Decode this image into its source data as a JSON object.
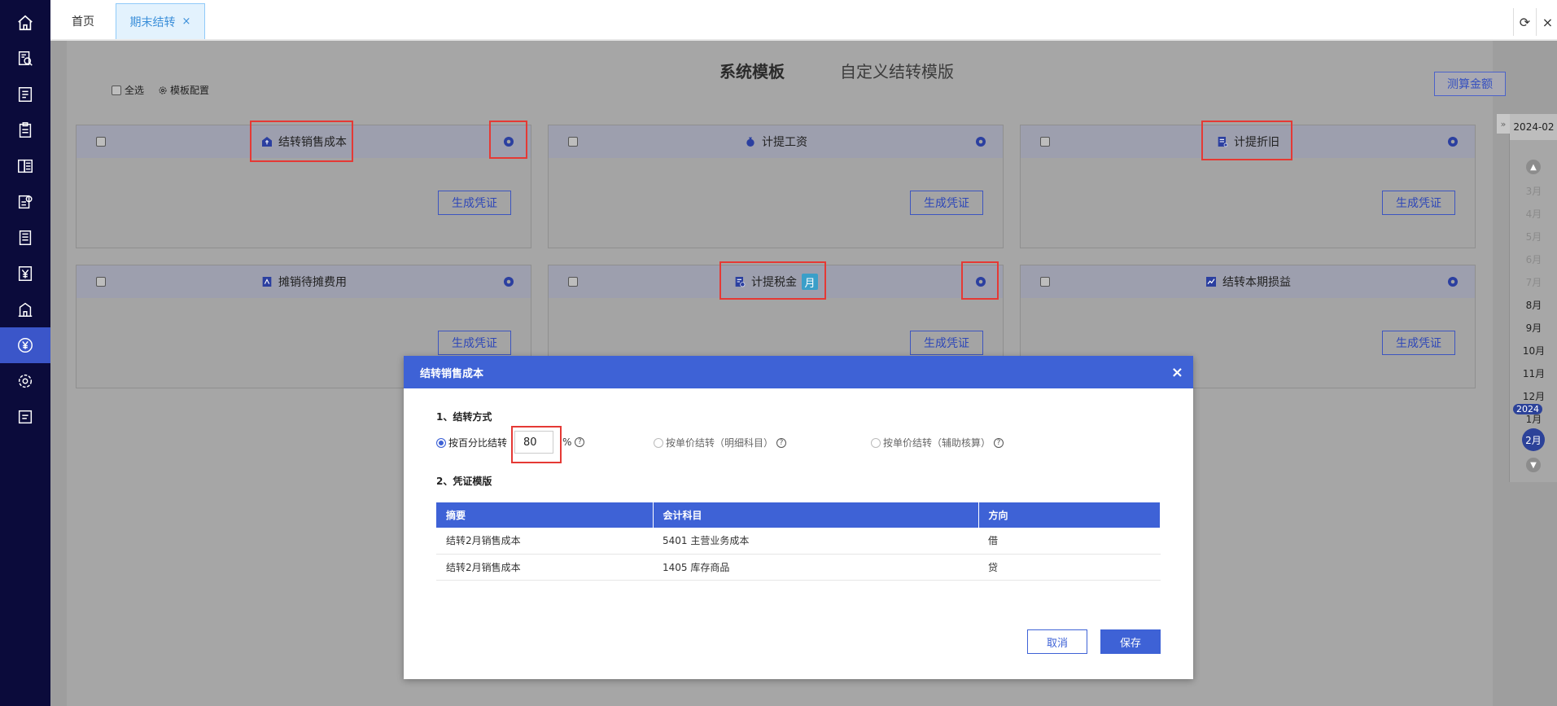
{
  "sidebar": {
    "items": [
      {
        "icon": "home-icon"
      },
      {
        "icon": "search-doc-icon"
      },
      {
        "icon": "list-doc-icon"
      },
      {
        "icon": "clipboard-icon"
      },
      {
        "icon": "ledger-icon"
      },
      {
        "icon": "report-icon"
      },
      {
        "icon": "notes-icon"
      },
      {
        "icon": "yen-icon"
      },
      {
        "icon": "building-icon"
      },
      {
        "icon": "yen-circle-icon",
        "active": true
      },
      {
        "icon": "gear-icon"
      },
      {
        "icon": "menu-icon"
      }
    ]
  },
  "tabs": {
    "home": "首页",
    "active": "期末结转",
    "close": "×"
  },
  "topbar": {
    "refresh": "⟳",
    "close": "×"
  },
  "page": {
    "system_template": "系统模板",
    "custom_template": "自定义结转模版",
    "select_all": "全选",
    "template_config": "模板配置",
    "calc_amount": "测算金额"
  },
  "cards": [
    {
      "title": "结转销售成本",
      "button": "生成凭证"
    },
    {
      "title": "计提工资",
      "button": "生成凭证"
    },
    {
      "title": "计提折旧",
      "button": "生成凭证"
    },
    {
      "title": "摊销待摊费用",
      "button": "生成凭证"
    },
    {
      "title": "计提税金",
      "badge": "月",
      "button": "生成凭证"
    },
    {
      "title": "结转本期损益",
      "button": "生成凭证"
    }
  ],
  "month_panel": {
    "year_label": "2024-02",
    "months": [
      "3月",
      "4月",
      "5月",
      "6月",
      "7月",
      "8月",
      "9月",
      "10月",
      "11月",
      "12月",
      "1月"
    ],
    "year_badge": "2024",
    "current": "2月",
    "collapse": "»"
  },
  "modal": {
    "title": "结转销售成本",
    "close": "×",
    "section1": "1、结转方式",
    "option_percent": "按百分比结转",
    "percent_value": "80",
    "percent_sign": "%",
    "option_unit_detail": "按单价结转（明细科目）",
    "option_unit_aux": "按单价结转（辅助核算）",
    "section2": "2、凭证模版",
    "table": {
      "headers": [
        "摘要",
        "会计科目",
        "方向"
      ],
      "rows": [
        [
          "结转2月销售成本",
          "5401 主营业务成本",
          "借"
        ],
        [
          "结转2月销售成本",
          "1405 库存商品",
          "贷"
        ]
      ]
    },
    "cancel": "取消",
    "save": "保存"
  },
  "colors": {
    "sidebar_bg": "#0b0b3b",
    "primary": "#3e62d6",
    "highlight_box": "#e53935",
    "tab_active": "#3b8fd9"
  }
}
